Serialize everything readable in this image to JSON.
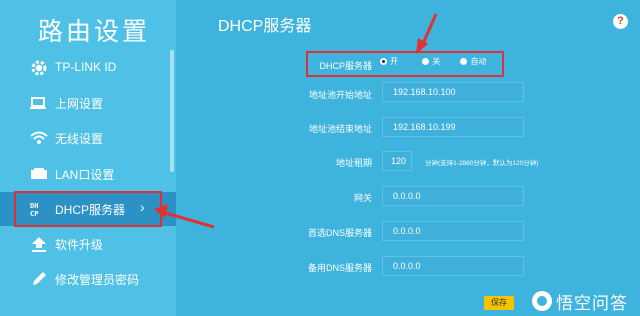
{
  "sidebar": {
    "title": "路由设置",
    "items": [
      {
        "label": "TP-LINK ID",
        "icon": "gear-icon"
      },
      {
        "label": "上网设置",
        "icon": "monitor-icon"
      },
      {
        "label": "无线设置",
        "icon": "wifi-icon"
      },
      {
        "label": "LAN口设置",
        "icon": "lan-port-icon"
      },
      {
        "label": "DHCP服务器",
        "icon": "dhcp-icon",
        "selected": true
      },
      {
        "label": "软件升级",
        "icon": "upload-icon"
      },
      {
        "label": "修改管理员密码",
        "icon": "pencil-icon"
      }
    ]
  },
  "main": {
    "title": "DHCP服务器",
    "help": "?",
    "dhcp_server": {
      "label": "DHCP服务器",
      "options": [
        "开",
        "关",
        "自动"
      ],
      "selected": "开"
    },
    "fields": {
      "pool_start": {
        "label": "地址池开始地址",
        "value": "192.168.10.100"
      },
      "pool_end": {
        "label": "地址池结束地址",
        "value": "192.168.10.199"
      },
      "lease": {
        "label": "地址租期",
        "value": "120",
        "hint": "分钟(支持1-2880分钟，默认为120分钟)"
      },
      "gateway": {
        "label": "网关",
        "value": "0.0.0.0"
      },
      "primary_dns": {
        "label": "首选DNS服务器",
        "value": "0.0.0.0"
      },
      "secondary_dns": {
        "label": "备用DNS服务器",
        "value": "0.0.0.0"
      }
    },
    "save_label": "保存"
  },
  "watermark": "悟空问答",
  "colors": {
    "accent": "#3db3dd",
    "sidebar": "#4fc1e6",
    "highlight": "#e03232",
    "button": "#f5c400"
  }
}
